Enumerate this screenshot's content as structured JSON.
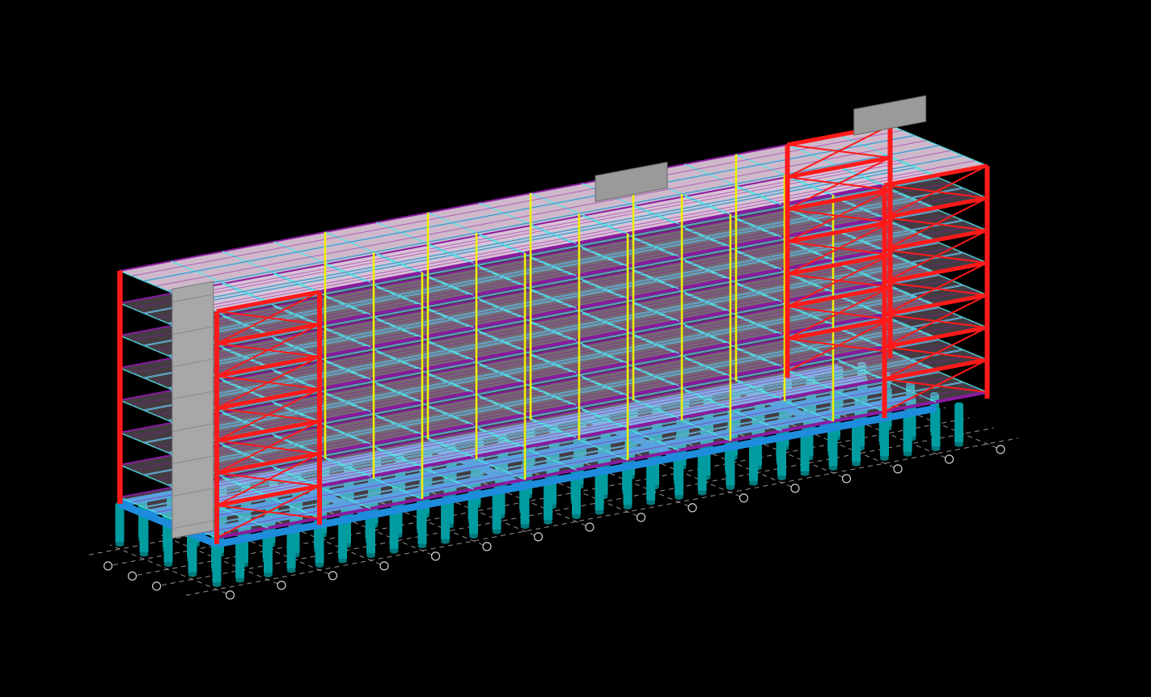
{
  "viewport": {
    "background": "#000000"
  },
  "legend_colors": {
    "braced_frame": "#ff1a1a",
    "perimeter_beam": "#8a1aa0",
    "girder": "#50e6e6",
    "column": "#f0f000",
    "pile": "#009ca0",
    "pile_cap_beam": "#1e8cdc",
    "slab": "#f4d8ee",
    "core_wall": "#a8a8a8",
    "grid_line": "#cfcfcf"
  },
  "building": {
    "floors": 7,
    "grid_x_count": 15,
    "grid_y_count": 4
  },
  "grid_bubbles": [
    {
      "label": ""
    },
    {
      "label": ""
    },
    {
      "label": ""
    },
    {
      "label": ""
    },
    {
      "label": ""
    },
    {
      "label": ""
    },
    {
      "label": ""
    },
    {
      "label": ""
    },
    {
      "label": ""
    },
    {
      "label": ""
    },
    {
      "label": ""
    },
    {
      "label": ""
    },
    {
      "label": ""
    },
    {
      "label": ""
    },
    {
      "label": ""
    },
    {
      "label": ""
    },
    {
      "label": ""
    },
    {
      "label": ""
    }
  ]
}
